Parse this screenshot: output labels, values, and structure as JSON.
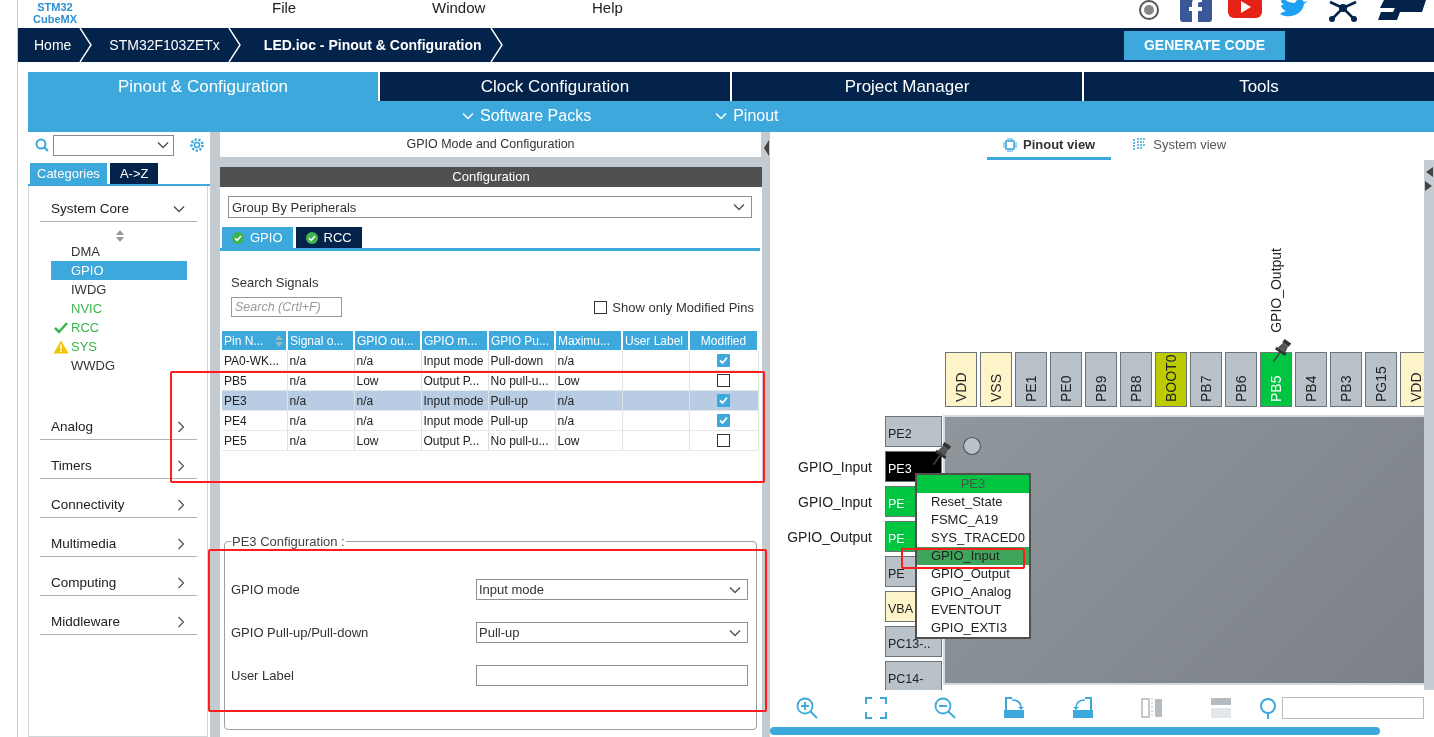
{
  "header": {
    "logo": [
      "STM32",
      "CubeMX"
    ],
    "menu": [
      "File",
      "Window",
      "Help"
    ]
  },
  "breadcrumb": [
    {
      "label": "Home",
      "current": false
    },
    {
      "label": "STM32F103ZETx",
      "current": false
    },
    {
      "label": "LED.ioc - Pinout & Configuration",
      "current": true
    }
  ],
  "generate_button": "GENERATE CODE",
  "main_tabs": [
    {
      "label": "Pinout & Configuration",
      "selected": true
    },
    {
      "label": "Clock Configuration",
      "selected": false
    },
    {
      "label": "Project Manager",
      "selected": false
    },
    {
      "label": "Tools",
      "selected": false
    }
  ],
  "sub_menu": [
    "Software Packs",
    "Pinout"
  ],
  "categories": {
    "tabs": [
      {
        "label": "Categories",
        "selected": true
      },
      {
        "label": "A->Z",
        "selected": false
      }
    ],
    "groups": [
      {
        "label": "System Core",
        "expanded": true,
        "items": [
          {
            "label": "DMA",
            "selected": false,
            "configured": false,
            "ok": false,
            "warning": false
          },
          {
            "label": "GPIO",
            "selected": true,
            "configured": false,
            "ok": false,
            "warning": false
          },
          {
            "label": "IWDG",
            "selected": false,
            "configured": false,
            "ok": false,
            "warning": false
          },
          {
            "label": "NVIC",
            "selected": false,
            "configured": true,
            "ok": false,
            "warning": false
          },
          {
            "label": "RCC",
            "selected": false,
            "configured": true,
            "ok": true,
            "warning": false
          },
          {
            "label": "SYS",
            "selected": false,
            "configured": true,
            "ok": false,
            "warning": true
          },
          {
            "label": "WWDG",
            "selected": false,
            "configured": false,
            "ok": false,
            "warning": false
          }
        ]
      },
      {
        "label": "Analog",
        "expanded": false
      },
      {
        "label": "Timers",
        "expanded": false
      },
      {
        "label": "Connectivity",
        "expanded": false
      },
      {
        "label": "Multimedia",
        "expanded": false
      },
      {
        "label": "Computing",
        "expanded": false
      },
      {
        "label": "Middleware",
        "expanded": false
      }
    ]
  },
  "mode_panel": {
    "title": "GPIO Mode and Configuration",
    "config_title": "Configuration",
    "grouping": "Group By Peripherals",
    "tabs": [
      {
        "label": "GPIO",
        "selected": true
      },
      {
        "label": "RCC",
        "selected": false
      }
    ],
    "search_label": "Search Signals",
    "search": {
      "placeholder": "Search (Crtl+F)"
    },
    "show_modified": {
      "label": "Show only Modified Pins",
      "checked": false
    },
    "table": {
      "columns": [
        {
          "label": "Pin N...",
          "sorted": true
        },
        {
          "label": "Signal o...",
          "sorted": false
        },
        {
          "label": "GPIO ou...",
          "sorted": false
        },
        {
          "label": "GPIO m...",
          "sorted": false
        },
        {
          "label": "GPIO Pu...",
          "sorted": false
        },
        {
          "label": "Maximu...",
          "sorted": false
        },
        {
          "label": "User Label",
          "sorted": false
        },
        {
          "label": "Modified",
          "sorted": false
        }
      ],
      "rows": [
        {
          "cells": [
            "PA0-WK...",
            "n/a",
            "n/a",
            "Input mode",
            "Pull-down",
            "n/a"
          ],
          "modified": true,
          "selected": false
        },
        {
          "cells": [
            "PB5",
            "n/a",
            "Low",
            "Output P...",
            "No pull-u...",
            "Low"
          ],
          "modified": false,
          "selected": false
        },
        {
          "cells": [
            "PE3",
            "n/a",
            "n/a",
            "Input mode",
            "Pull-up",
            "n/a"
          ],
          "modified": true,
          "selected": true
        },
        {
          "cells": [
            "PE4",
            "n/a",
            "n/a",
            "Input mode",
            "Pull-up",
            "n/a"
          ],
          "modified": true,
          "selected": false
        },
        {
          "cells": [
            "PE5",
            "n/a",
            "Low",
            "Output P...",
            "No pull-u...",
            "Low"
          ],
          "modified": false,
          "selected": false
        }
      ]
    },
    "pin_config": {
      "title": "PE3 Configuration :",
      "fields": [
        {
          "kind": "select",
          "label": "GPIO mode",
          "value": "Input mode"
        },
        {
          "kind": "select",
          "label": "GPIO Pull-up/Pull-down",
          "value": "Pull-up"
        },
        {
          "kind": "text",
          "label": "User Label"
        }
      ]
    }
  },
  "pinout": {
    "views": [
      {
        "label": "Pinout view",
        "selected": true
      },
      {
        "label": "System view",
        "selected": false
      }
    ],
    "top_pins": [
      {
        "name": "VDD",
        "kind": "power",
        "pinned": false
      },
      {
        "name": "VSS",
        "kind": "power",
        "pinned": false
      },
      {
        "name": "PE1",
        "kind": "io",
        "pinned": false
      },
      {
        "name": "PE0",
        "kind": "io",
        "pinned": false
      },
      {
        "name": "PB9",
        "kind": "io",
        "pinned": false
      },
      {
        "name": "PB8",
        "kind": "io",
        "pinned": false
      },
      {
        "name": "BOOT0",
        "kind": "boot",
        "pinned": false
      },
      {
        "name": "PB7",
        "kind": "io",
        "pinned": false
      },
      {
        "name": "PB6",
        "kind": "io",
        "pinned": false
      },
      {
        "name": "PB5",
        "kind": "assigned",
        "pinned": true,
        "signal": "GPIO_Output"
      },
      {
        "name": "PB4",
        "kind": "io",
        "pinned": false
      },
      {
        "name": "PB3",
        "kind": "io",
        "pinned": false
      },
      {
        "name": "PG15",
        "kind": "io",
        "pinned": false
      },
      {
        "name": "VDD",
        "kind": "power",
        "pinned": false
      }
    ],
    "left_pins": [
      {
        "name": "PE2",
        "kind": "io",
        "pinned": false
      },
      {
        "name": "PE3",
        "kind": "selected",
        "pinned": true,
        "signal": "GPIO_Input"
      },
      {
        "name": "PE",
        "kind": "assigned",
        "pinned": false,
        "signal": "GPIO_Input"
      },
      {
        "name": "PE",
        "kind": "assigned",
        "pinned": false,
        "signal": "GPIO_Output"
      },
      {
        "name": "PE",
        "kind": "io",
        "pinned": false
      },
      {
        "name": "VBA",
        "kind": "power",
        "pinned": false
      },
      {
        "name": "PC13-..",
        "kind": "io",
        "pinned": false
      },
      {
        "name": "PC14-",
        "kind": "io",
        "pinned": false
      }
    ],
    "pin_menu": {
      "title": "PE3",
      "items": [
        {
          "label": "Reset_State",
          "selected": false
        },
        {
          "label": "FSMC_A19",
          "selected": false
        },
        {
          "label": "SYS_TRACED0",
          "selected": false
        },
        {
          "label": "GPIO_Input",
          "selected": true
        },
        {
          "label": "GPIO_Output",
          "selected": false
        },
        {
          "label": "GPIO_Analog",
          "selected": false
        },
        {
          "label": "EVENTOUT",
          "selected": false
        },
        {
          "label": "GPIO_EXTI3",
          "selected": false
        }
      ]
    }
  }
}
